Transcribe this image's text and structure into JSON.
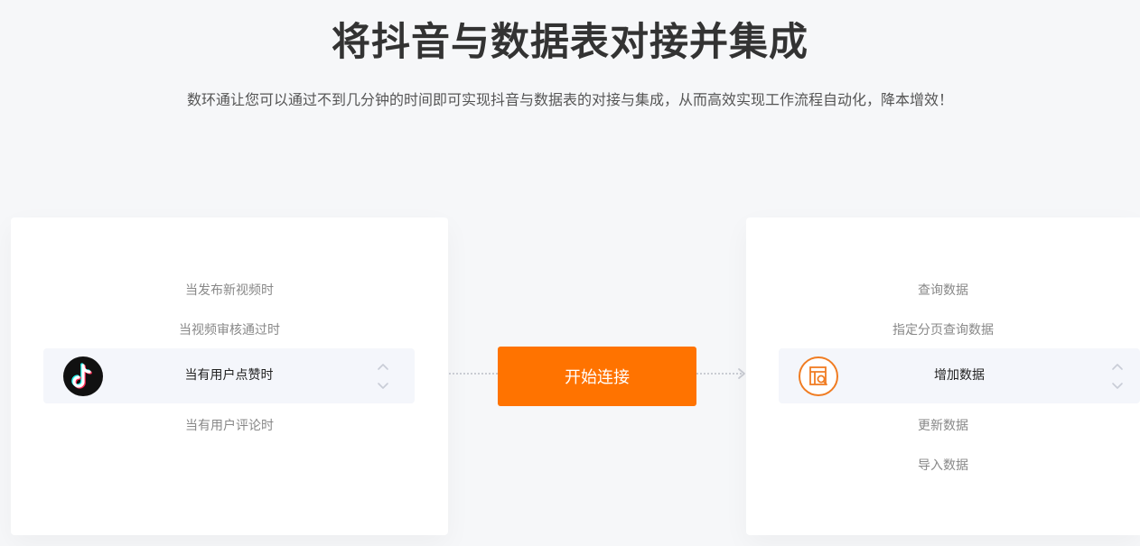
{
  "header": {
    "title": "将抖音与数据表对接并集成",
    "subtitle": "数环通让您可以通过不到几分钟的时间即可实现抖音与数据表的对接与集成，从而高效实现工作流程自动化，降本增效！"
  },
  "trigger_panel": {
    "app_icon": "tiktok-logo-icon",
    "options": {
      "item1": "当发布新视频时",
      "item2": "当视频审核通过时",
      "selected": "当有用户点赞时",
      "item4": "当有用户评论时"
    }
  },
  "action_panel": {
    "app_icon": "data-sheet-icon",
    "options": {
      "item1": "查询数据",
      "item2": "指定分页查询数据",
      "selected": "增加数据",
      "item4": "更新数据",
      "item5": "导入数据"
    }
  },
  "connect_button": {
    "label": "开始连接"
  },
  "colors": {
    "accent": "#ff7300",
    "sheet_icon": "#f07c22",
    "title": "#333333",
    "background": "#f6f7f9"
  }
}
